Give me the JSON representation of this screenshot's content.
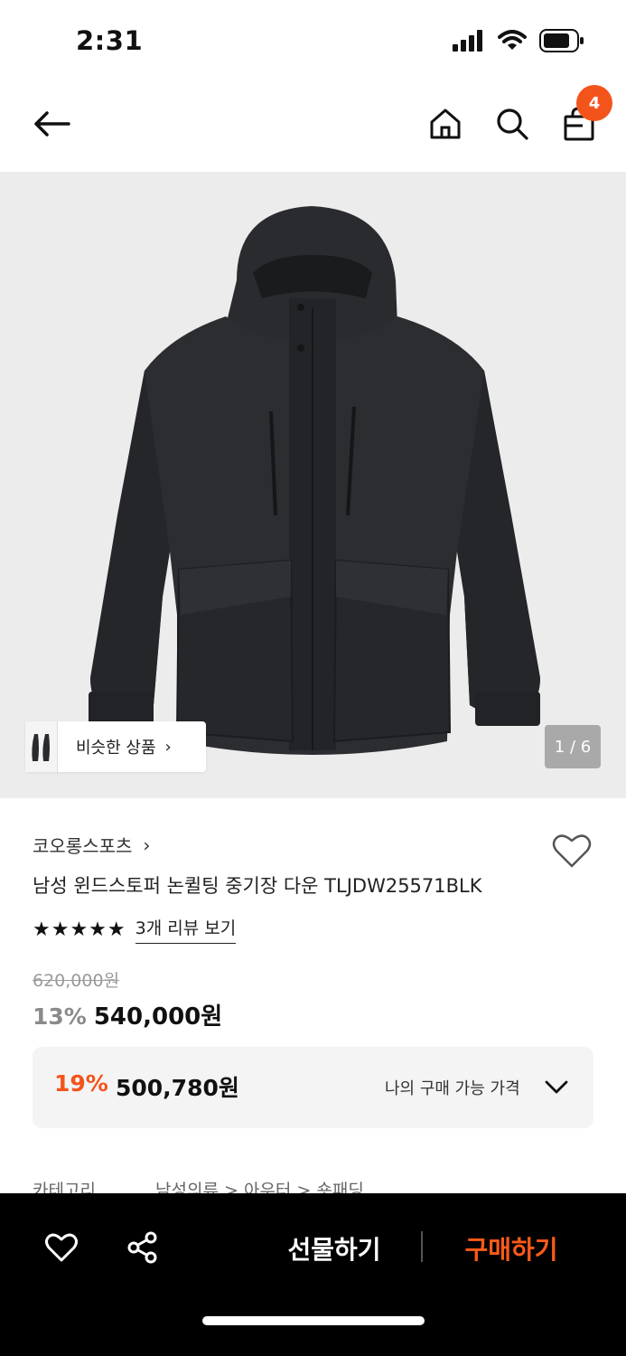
{
  "status": {
    "time": "2:31"
  },
  "nav": {
    "cart_count": "4",
    "icons": [
      "back-arrow-icon",
      "home-icon",
      "search-icon",
      "shopping-bag-icon"
    ]
  },
  "gallery": {
    "similar_label": "비슷한 상품",
    "counter": "1 / 6"
  },
  "product": {
    "brand": "코오롱스포츠",
    "title": "남성 윈드스토퍼 논퀼팅 중기장 다운 TLJDW25571BLK",
    "stars": "★★★★★",
    "rating": 5,
    "review_link": "3개 리뷰 보기",
    "original_price": "620,000원",
    "discount": "13%",
    "price": "540,000원"
  },
  "my_price": {
    "discount": "19%",
    "price": "500,780원",
    "label": "나의 구매 가능 가격"
  },
  "category": {
    "label": "카테고리",
    "path": "남성의류 > 아우터 > 숏패딩"
  },
  "bottom_bar": {
    "gift": "선물하기",
    "buy": "구매하기"
  },
  "colors": {
    "accent": "#f3541c",
    "buy": "#ff5a1a"
  }
}
